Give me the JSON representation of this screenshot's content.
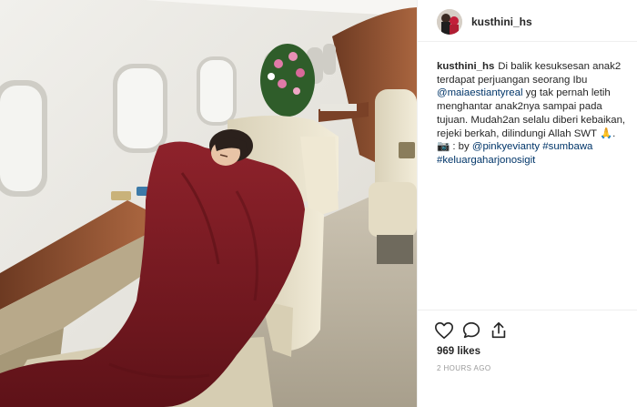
{
  "post": {
    "username": "kusthini_hs",
    "caption": {
      "username": "kusthini_hs",
      "text1": "Di balik kesuksesan anak2 terdapat perjuangan seorang Ibu ",
      "mention1": "@maiaestiantyreal",
      "text2": " yg tak pernah letih menghantar anak2nya sampai pada tujuan. Mudah2an selalu diberi kebaikan, rejeki berkah, dilindungi Allah SWT 🙏. 📷 : by ",
      "mention2": "@pinkyevianty",
      "hashtag1": "#sumbawa",
      "hashtag2": "#keluargaharjonosigit"
    },
    "likes": "969 likes",
    "timestamp": "2 HOURS AGO"
  },
  "icons": {
    "like": "heart-icon",
    "comment": "comment-icon",
    "share": "share-icon"
  },
  "colors": {
    "link": "#003569",
    "timestamp": "#999999",
    "blanket": "#7a1c22",
    "seat": "#e6dfc8",
    "wood": "#8a4a2a"
  }
}
